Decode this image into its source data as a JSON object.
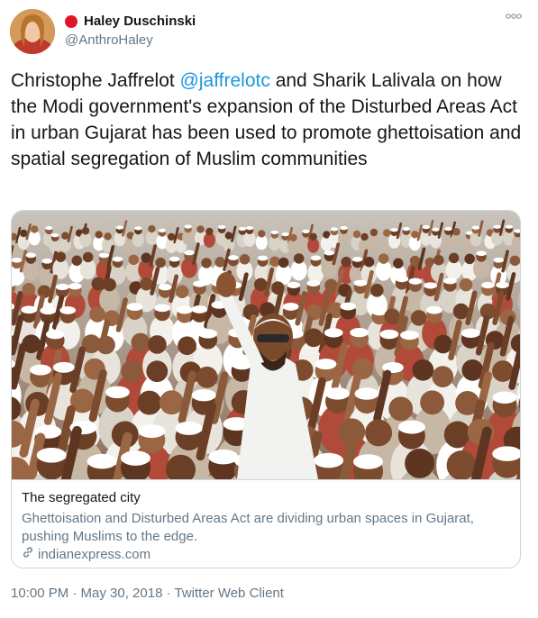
{
  "author": {
    "display_name": "Haley Duschinski",
    "handle": "@AnthroHaley"
  },
  "tweet": {
    "text_before": "Christophe Jaffrelot ",
    "mention": "@jaffrelotc",
    "text_after": " and Sharik Lalivala on how the Modi government's expansion of the Disturbed Areas Act in urban Gujarat has been used to promote ghettoisation and spatial segregation of Muslim communities"
  },
  "card": {
    "title": "The segregated city",
    "description": "Ghettoisation and Disturbed Areas Act are dividing urban spaces in Gujarat, pushing Muslims to the edge.",
    "domain": "indianexpress.com"
  },
  "meta": {
    "timestamp": "10:00 PM · May 30, 2018 · Twitter Web Client"
  },
  "icons": {
    "more": "more-options-icon",
    "link": "link-icon"
  },
  "colors": {
    "accent": "#1b95e0",
    "status_dot": "#e0152b",
    "secondary_text": "#657786"
  }
}
